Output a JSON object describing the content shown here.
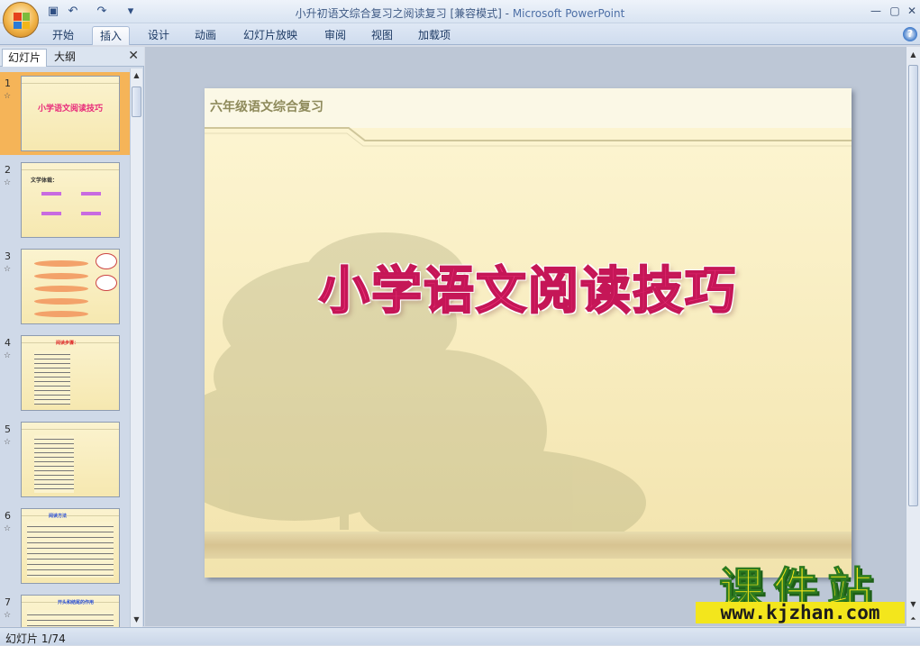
{
  "window": {
    "title": "小升初语文综合复习之阅读复习 [兼容模式]",
    "app_name": "Microsoft PowerPoint",
    "separator": " - ",
    "minimize": "—",
    "maximize": "▢",
    "close": "✕"
  },
  "qat": {
    "save_icon": "save-icon",
    "undo_icon": "undo-icon",
    "redo_icon": "redo-icon",
    "customize_icon": "dropdown-icon"
  },
  "ribbon": {
    "tabs": [
      "开始",
      "插入",
      "设计",
      "动画",
      "幻灯片放映",
      "审阅",
      "视图",
      "加载项"
    ],
    "active_tab": "插入",
    "help": "?"
  },
  "left_pane": {
    "tabs": [
      "幻灯片",
      "大纲"
    ],
    "active_tab": "幻灯片",
    "close": "✕",
    "thumbnails": [
      {
        "number": "1",
        "title": "小学语文阅读技巧"
      },
      {
        "number": "2",
        "title": "文学体裁："
      },
      {
        "number": "3",
        "title": ""
      },
      {
        "number": "4",
        "title": "阅读步骤："
      },
      {
        "number": "5",
        "title": ""
      },
      {
        "number": "6",
        "title": "阅读方法"
      },
      {
        "number": "7",
        "title": "开头和结尾的作用"
      }
    ]
  },
  "slide": {
    "subtitle": "六年级语文综合复习",
    "title": "小学语文阅读技巧"
  },
  "watermark": {
    "cn": "课件站",
    "url": "www.kjzhan.com"
  },
  "status": {
    "text": "幻灯片 1/74"
  },
  "colors": {
    "title_pink": "#f0327e",
    "accent_orange": "#f5b458",
    "watermark_yellow": "#f5e61a"
  }
}
